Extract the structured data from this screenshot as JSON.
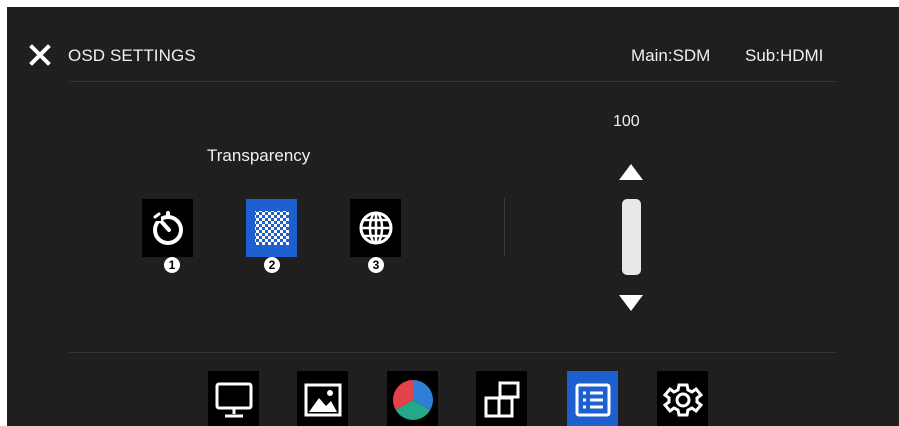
{
  "header": {
    "title": "OSD SETTINGS",
    "main_source": "Main:SDM",
    "sub_source": "Sub:HDMI"
  },
  "setting": {
    "label": "Transparency",
    "value": "100",
    "options": [
      {
        "number": "1",
        "icon": "timer-icon",
        "selected": false
      },
      {
        "number": "2",
        "icon": "checkerboard-icon",
        "selected": true
      },
      {
        "number": "3",
        "icon": "globe-icon",
        "selected": false
      }
    ]
  },
  "menu": {
    "items": [
      {
        "icon": "monitor-icon",
        "selected": false
      },
      {
        "icon": "picture-icon",
        "selected": false
      },
      {
        "icon": "color-wheel-icon",
        "selected": false
      },
      {
        "icon": "pip-icon",
        "selected": false
      },
      {
        "icon": "osd-list-icon",
        "selected": true
      },
      {
        "icon": "gear-icon",
        "selected": false
      }
    ]
  },
  "colors": {
    "background": "#1f1f1f",
    "accent": "#1e5fcf",
    "text": "#f0f0f0"
  }
}
